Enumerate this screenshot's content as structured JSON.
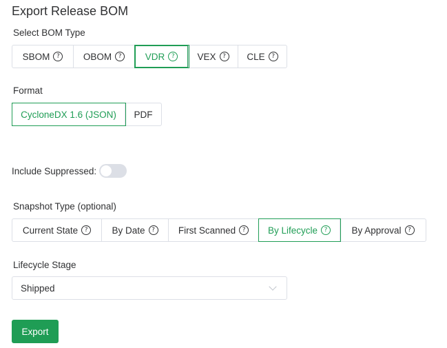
{
  "title": "Export Release BOM",
  "bom_type": {
    "label": "Select BOM Type",
    "options": [
      "SBOM",
      "OBOM",
      "VDR",
      "VEX",
      "CLE"
    ],
    "selected": "VDR"
  },
  "format": {
    "label": "Format",
    "options": [
      "CycloneDX 1.6 (JSON)",
      "PDF"
    ],
    "selected": "CycloneDX 1.6 (JSON)"
  },
  "include_suppressed": {
    "label": "Include Suppressed:",
    "enabled": false
  },
  "snapshot_type": {
    "label": "Snapshot Type (optional)",
    "options": [
      "Current State",
      "By Date",
      "First Scanned",
      "By Lifecycle",
      "By Approval"
    ],
    "selected": "By Lifecycle"
  },
  "lifecycle_stage": {
    "label": "Lifecycle Stage",
    "value": "Shipped"
  },
  "export_button": "Export",
  "icons": {
    "help": "question-circle-icon",
    "dropdown": "chevron-down-icon"
  },
  "colors": {
    "accent": "#1f9d55",
    "border": "#dcdfe6",
    "text": "#303133"
  }
}
